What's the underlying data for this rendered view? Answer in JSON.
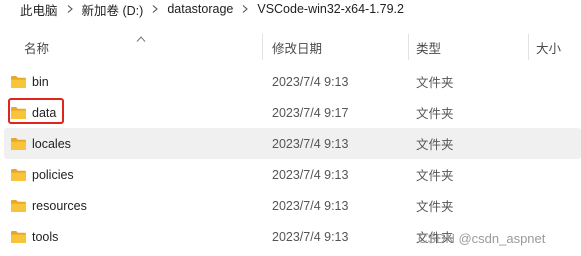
{
  "breadcrumb": {
    "items": [
      "此电脑",
      "新加卷 (D:)",
      "datastorage",
      "VSCode-win32-x64-1.79.2"
    ]
  },
  "columns": {
    "name": "名称",
    "date_modified": "修改日期",
    "type": "类型",
    "size": "大小"
  },
  "rows": [
    {
      "name": "bin",
      "date": "2023/7/4 9:13",
      "type": "文件夹",
      "selected": false,
      "highlighted": false
    },
    {
      "name": "data",
      "date": "2023/7/4 9:17",
      "type": "文件夹",
      "selected": false,
      "highlighted": true
    },
    {
      "name": "locales",
      "date": "2023/7/4 9:13",
      "type": "文件夹",
      "selected": true,
      "highlighted": false
    },
    {
      "name": "policies",
      "date": "2023/7/4 9:13",
      "type": "文件夹",
      "selected": false,
      "highlighted": false
    },
    {
      "name": "resources",
      "date": "2023/7/4 9:13",
      "type": "文件夹",
      "selected": false,
      "highlighted": false
    },
    {
      "name": "tools",
      "date": "2023/7/4 9:13",
      "type": "文件夹",
      "selected": false,
      "highlighted": false
    }
  ],
  "watermark": "CSDN @csdn_aspnet",
  "colors": {
    "folder": "#f8c53a",
    "folder_dark": "#e8a825",
    "highlight_border": "#e0251b",
    "selected_row": "#f0f0f0"
  },
  "icons": {
    "breadcrumb_separator": "chevron-right-icon",
    "sort": "sort-ascending-icon",
    "folder": "folder-icon"
  }
}
